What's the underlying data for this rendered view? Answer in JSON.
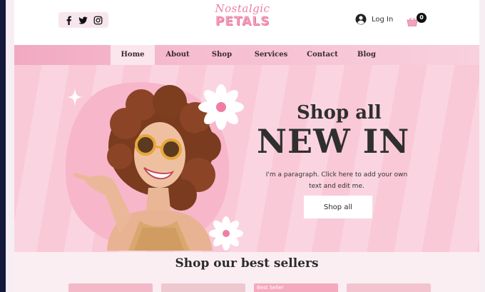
{
  "header": {
    "social": [
      "facebook-icon",
      "twitter-icon",
      "instagram-icon"
    ],
    "logo_script": "Nostalgic",
    "logo_main": "PETALS",
    "login_label": "Log In",
    "cart_count": "0"
  },
  "nav": {
    "items": [
      {
        "label": "Home",
        "active": true
      },
      {
        "label": "About",
        "active": false
      },
      {
        "label": "Shop",
        "active": false
      },
      {
        "label": "Services",
        "active": false
      },
      {
        "label": "Contact",
        "active": false
      },
      {
        "label": "Blog",
        "active": false
      }
    ]
  },
  "hero": {
    "title_line1": "Shop all",
    "title_line2": "NEW IN",
    "paragraph": "I'm a paragraph. Click here to add your own text and edit me.",
    "button_label": "Shop all"
  },
  "best_sellers": {
    "title": "Shop our best sellers",
    "badge": "Best Seller"
  },
  "colors": {
    "accent_pink": "#f49ab8",
    "nav_pink": "#f1a9c1",
    "hero_pink": "#f9c9d8",
    "text_dark": "#2f2f2f"
  }
}
